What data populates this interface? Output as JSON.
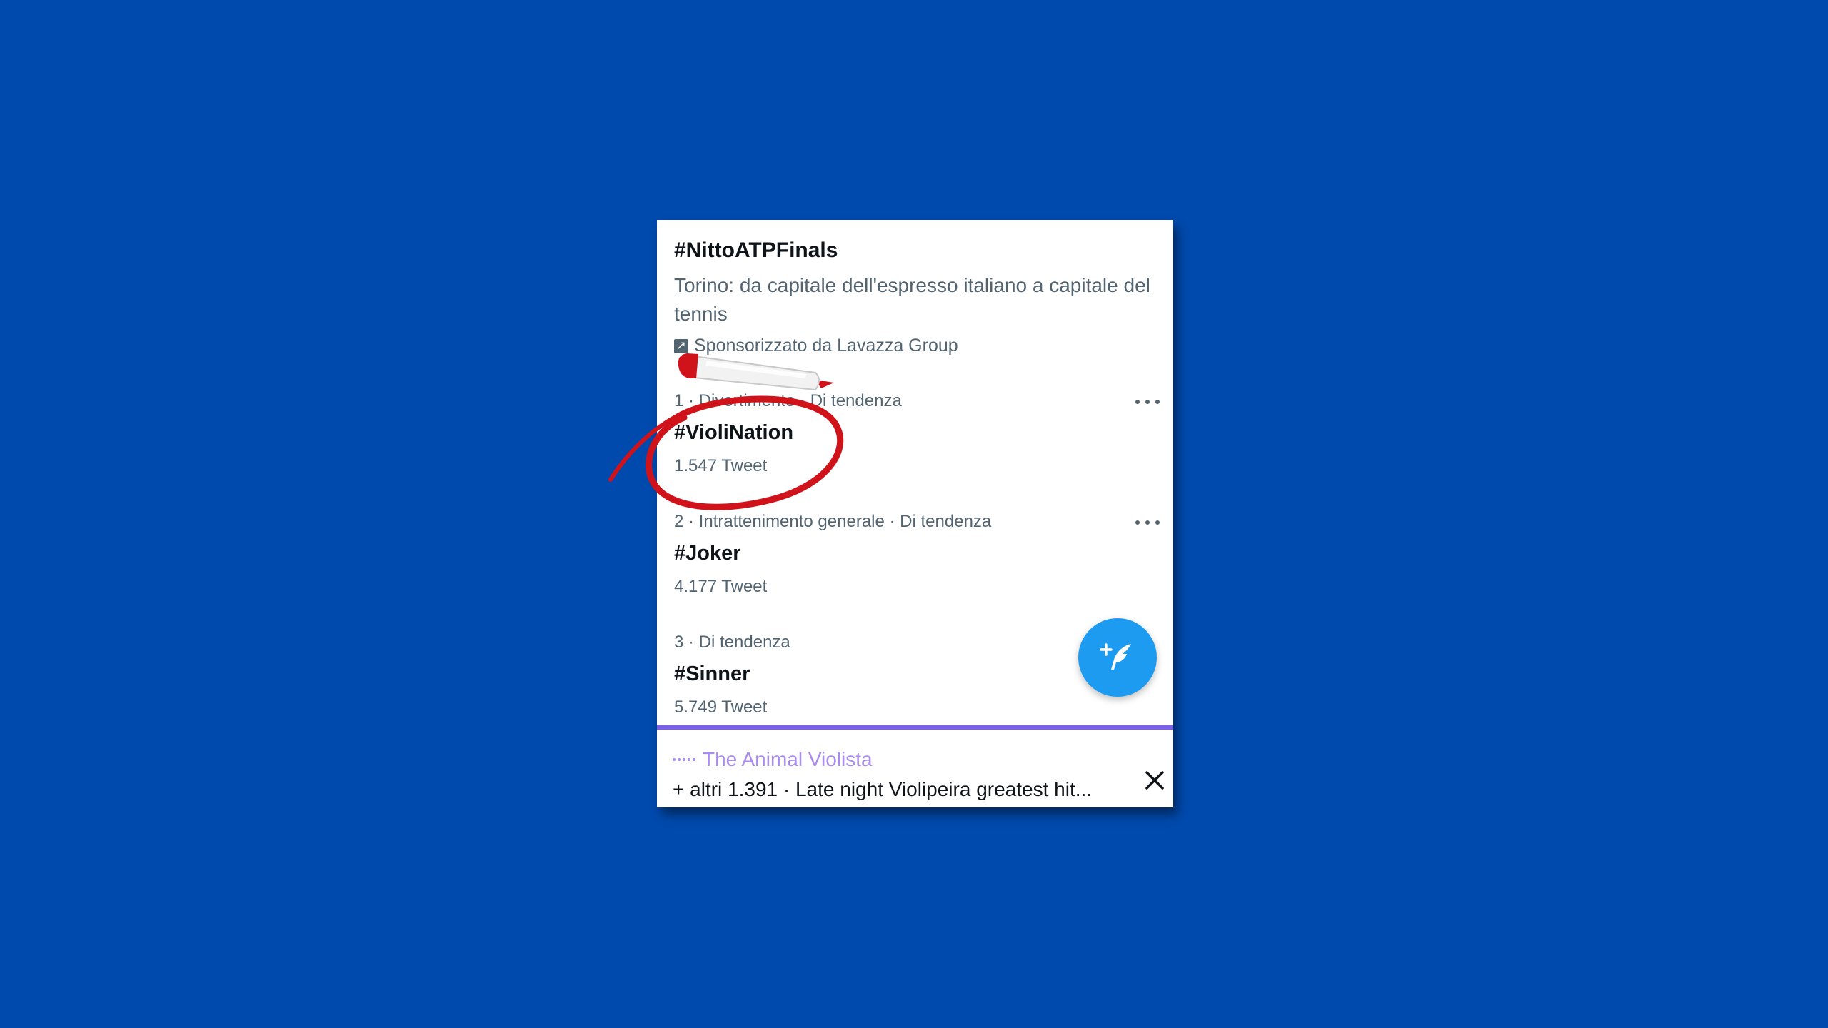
{
  "promo": {
    "tag": "#NittoATPFinals",
    "description": "Torino: da capitale dell'espresso italiano a capitale del tennis",
    "sponsor": "Sponsorizzato da Lavazza Group"
  },
  "trends": [
    {
      "meta": "1 · Divertimento · Di tendenza",
      "tag": "#VioliNation",
      "count": "1.547 Tweet"
    },
    {
      "meta": "2 · Intrattenimento generale · Di tendenza",
      "tag": "#Joker",
      "count": "4.177 Tweet"
    },
    {
      "meta": "3 · Di tendenza",
      "tag": "#Sinner",
      "count": "5.749 Tweet"
    }
  ],
  "player": {
    "title": "The Animal Violista",
    "subtitle": "+ altri 1.391 · Late night Violipeira greatest hit..."
  },
  "colors": {
    "background": "#004aad",
    "accent_blue": "#1d9bf0",
    "player_purple": "#7b61e8",
    "marker_red": "#d0131b"
  },
  "icons": {
    "promoted": "promoted-arrow-icon",
    "more": "more-horizontal-icon",
    "compose": "compose-tweet-icon",
    "close": "close-icon",
    "annotation": "red-marker-pen"
  }
}
